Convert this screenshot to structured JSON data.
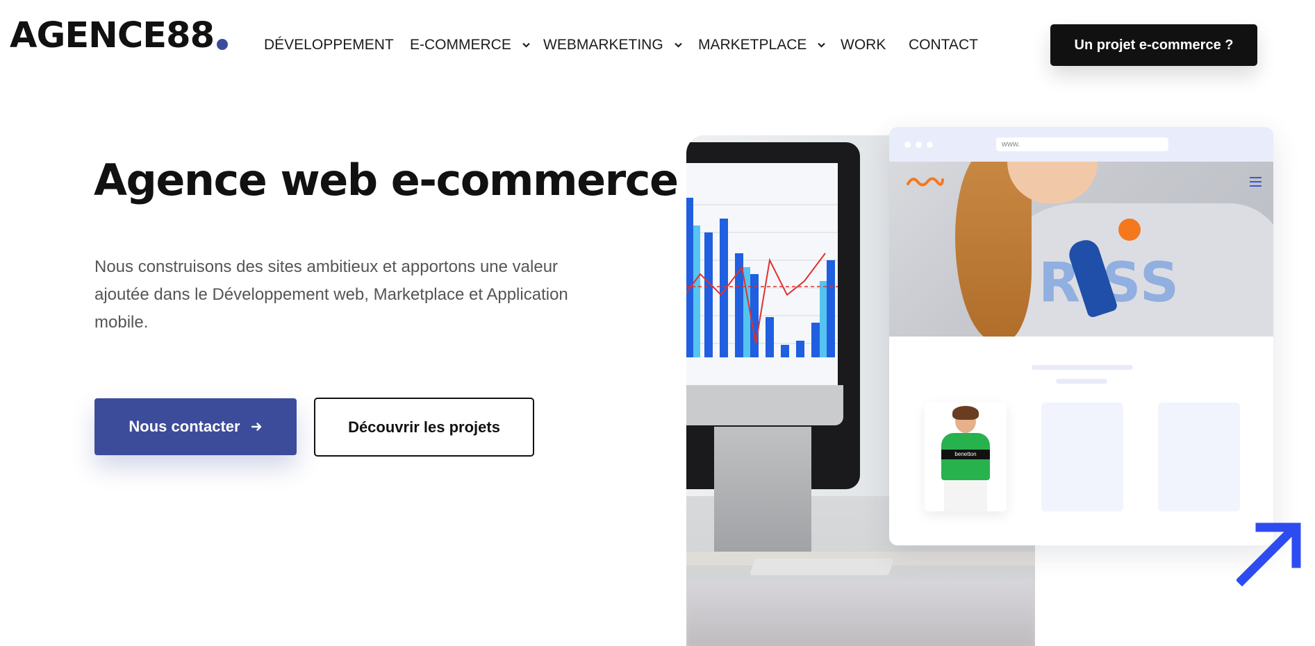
{
  "brand": {
    "logo_text": "AGENCE88",
    "accent_color": "#3d4c9a"
  },
  "nav": {
    "items": [
      {
        "label": "DÉVELOPPEMENT",
        "has_dropdown": false
      },
      {
        "label": "E-COMMERCE",
        "has_dropdown": true
      },
      {
        "label": "WEBMARKETING",
        "has_dropdown": true
      },
      {
        "label": "MARKETPLACE",
        "has_dropdown": true
      },
      {
        "label": "WORK",
        "has_dropdown": false
      },
      {
        "label": "CONTACT",
        "has_dropdown": false
      }
    ],
    "cta_label": "Un projet e-commerce ?"
  },
  "hero": {
    "title": "Agence web e-commerce",
    "description": "Nous construisons des sites ambitieux et apportons une valeur ajoutée dans le Développement web, Marketplace et Application mobile.",
    "primary_button": "Nous contacter",
    "primary_button_icon": "arrow-right-icon",
    "secondary_button": "Découvrir les projets"
  },
  "illustration": {
    "browser_url": "www.",
    "product_brand": "benetton",
    "arrow_icon": "arrow-up-right-icon",
    "arrow_color": "#2d4cf0"
  }
}
